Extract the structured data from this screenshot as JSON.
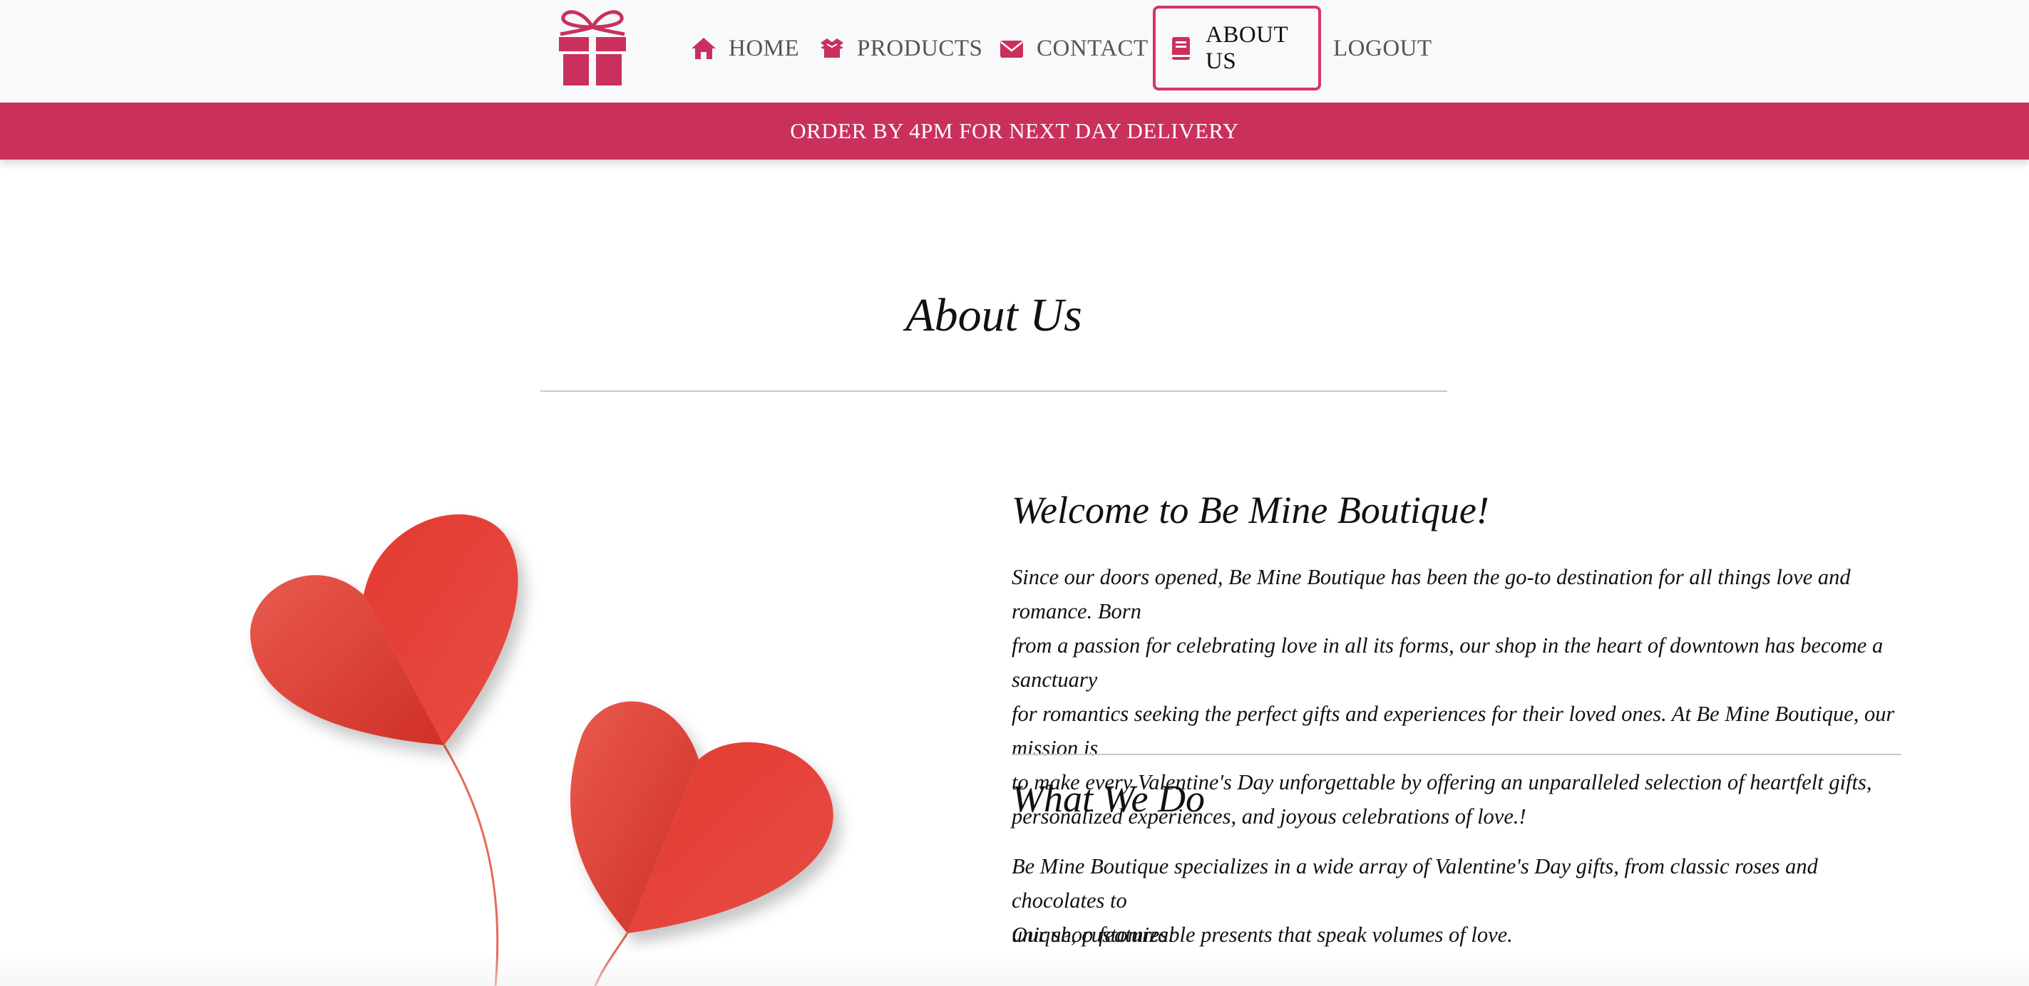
{
  "nav": {
    "logo_icon": "gift-box-icon",
    "items": [
      {
        "label": "HOME",
        "icon": "house-icon"
      },
      {
        "label": "PRODUCTS",
        "icon": "box-open-icon"
      },
      {
        "label": "CONTACT",
        "icon": "envelope-icon"
      },
      {
        "label": "ABOUT US",
        "icon": "book-icon",
        "active": true
      },
      {
        "label": "LOGOUT"
      }
    ]
  },
  "banner": {
    "text": "ORDER BY 4PM FOR NEXT DAY DELIVERY"
  },
  "main": {
    "title": "About Us",
    "welcome_heading": "Welcome to Be Mine Boutique!",
    "welcome_lines": [
      "Since our doors opened, Be Mine Boutique has been the go-to destination for all things love and romance. Born",
      "from a passion for celebrating love in all its forms, our shop in the heart of downtown has become a sanctuary",
      "for romantics seeking the perfect gifts and experiences for their loved ones. At Be Mine Boutique, our mission is",
      "to make every Valentine's Day unforgettable by offering an unparalleled selection of heartfelt gifts,",
      "personalized experiences, and joyous celebrations of love.!"
    ],
    "what_heading": "What We Do",
    "what_lines": [
      "Be Mine Boutique specializes in a wide array of Valentine's Day gifts, from classic roses and chocolates to",
      "unique, customizable presents that speak volumes of love."
    ],
    "features_intro": "Our shop features:"
  },
  "colors": {
    "brand": "#c9315c",
    "active_border": "#d6336c",
    "heart_red": "#e23b32"
  }
}
